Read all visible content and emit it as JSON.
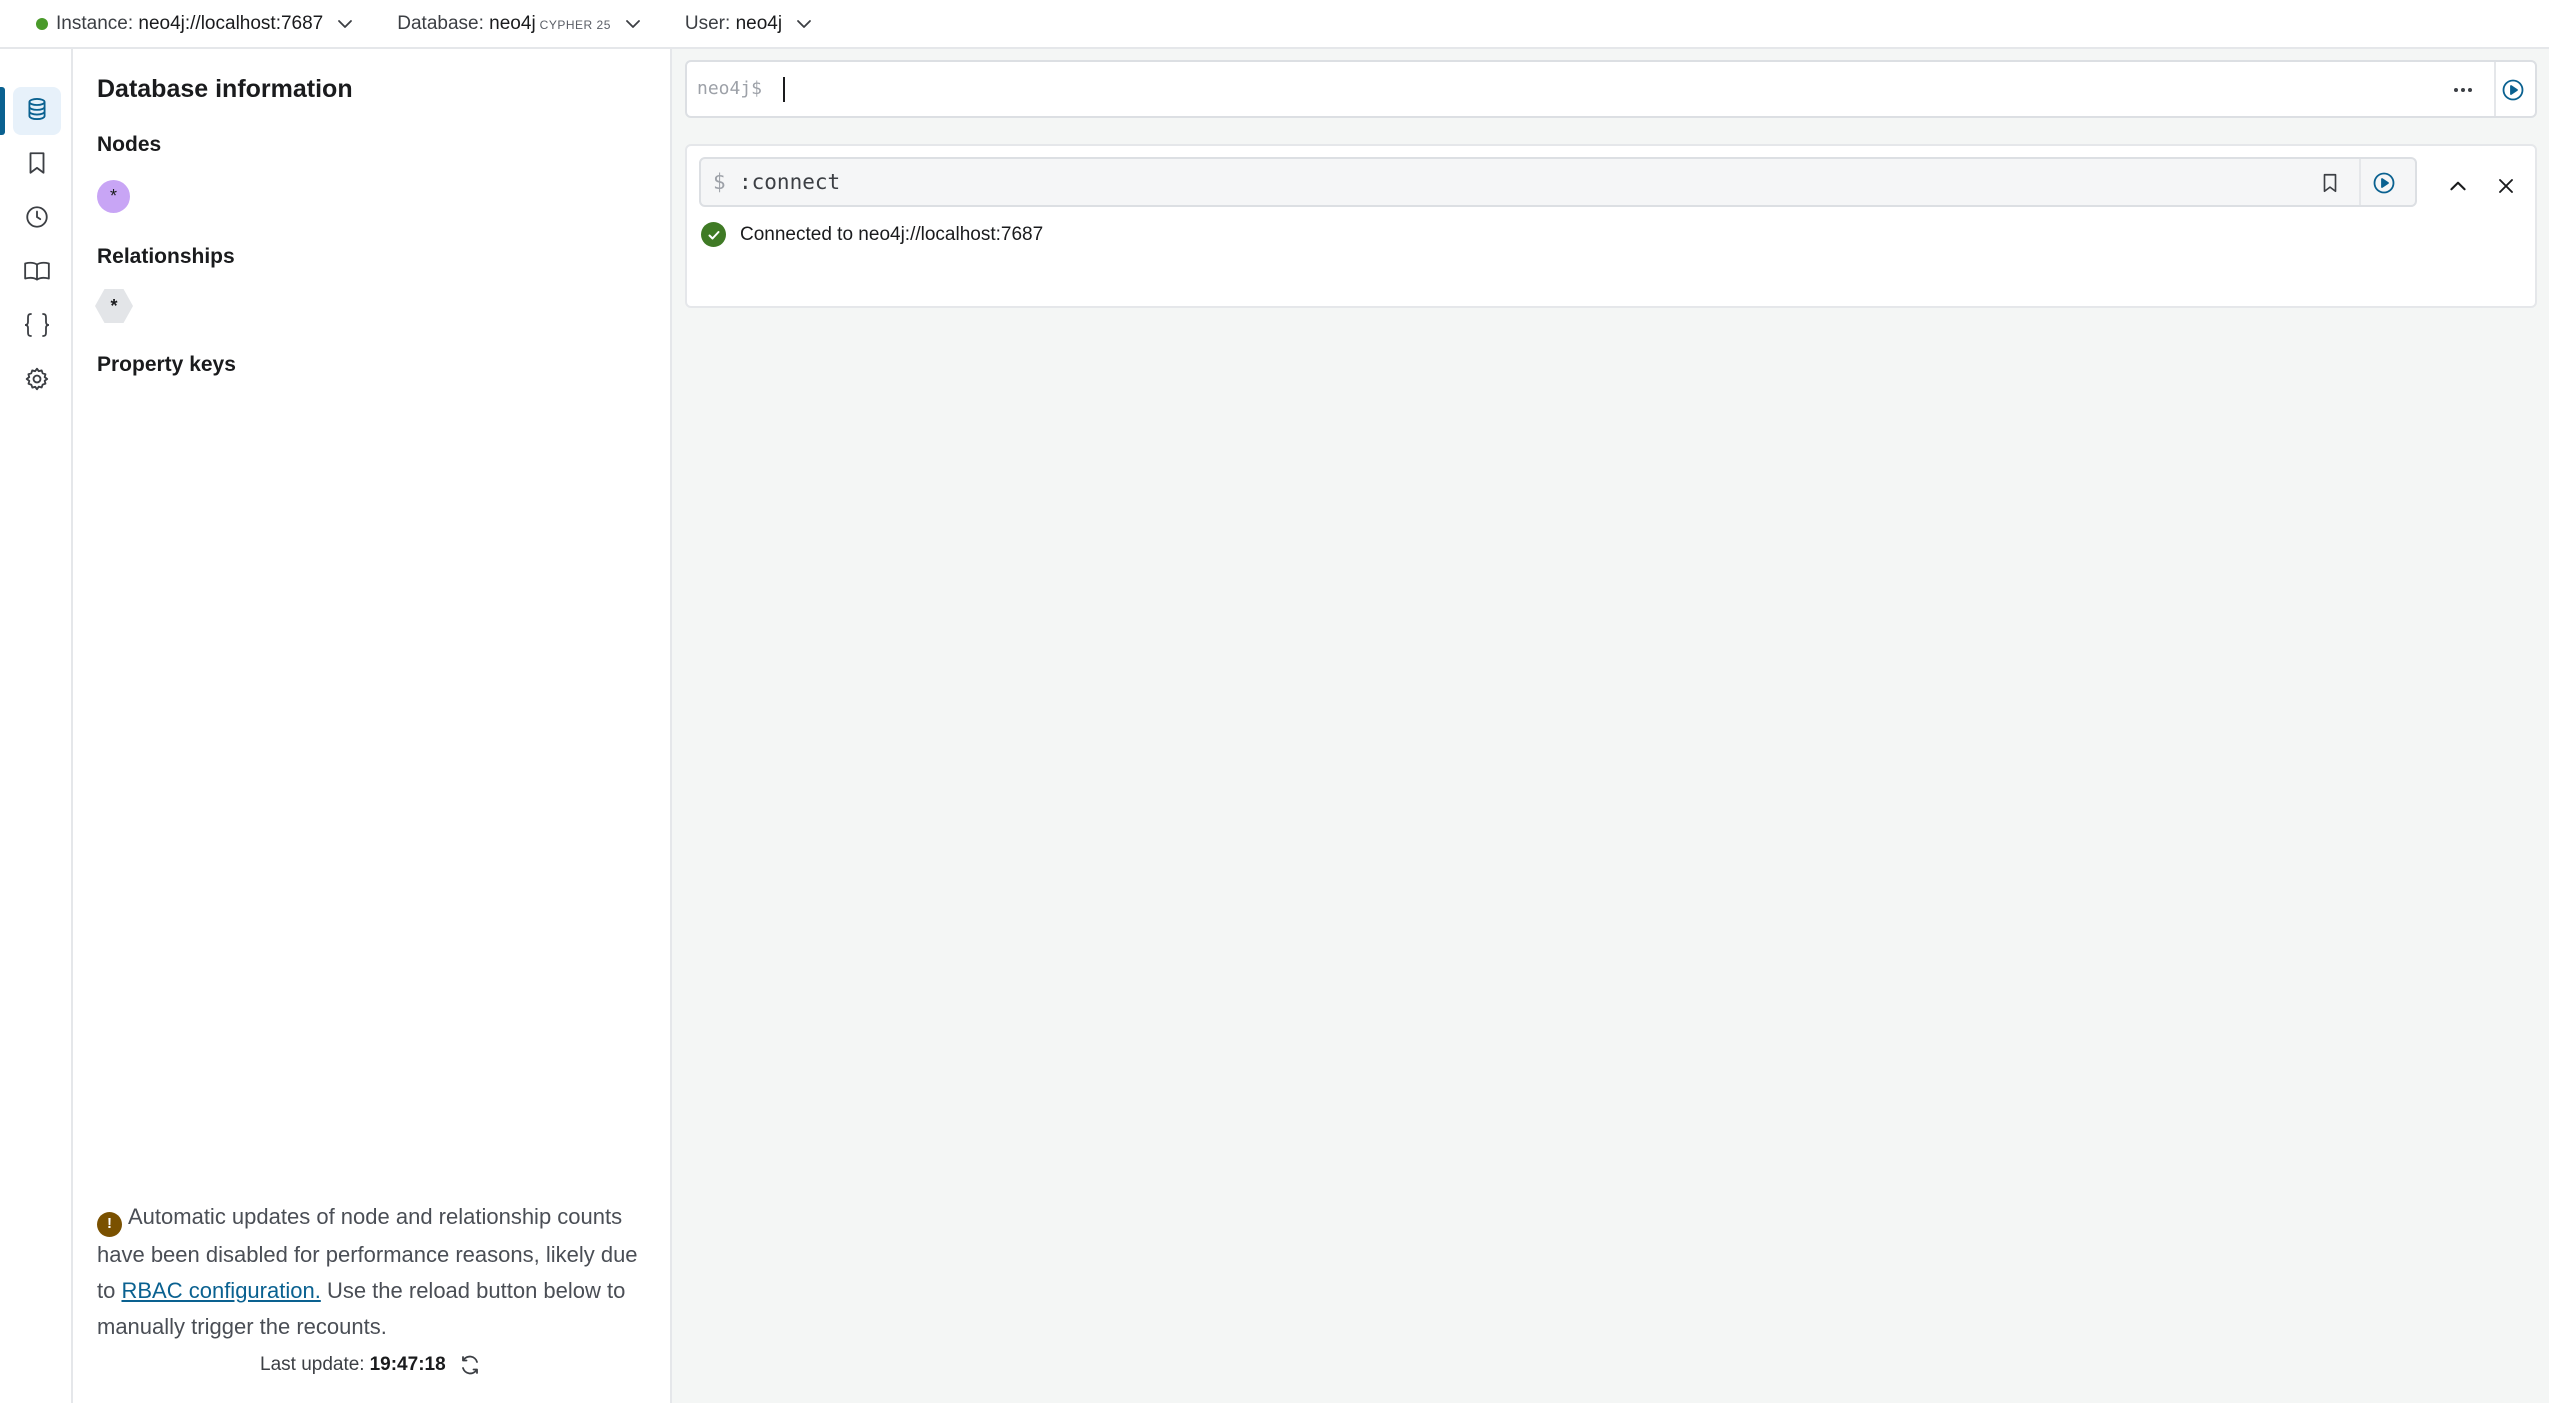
{
  "topbar": {
    "instance_label": "Instance:",
    "instance_value": "neo4j://localhost:7687",
    "database_label": "Database:",
    "database_value": "neo4j",
    "cypher_version": "CYPHER 25",
    "user_label": "User:",
    "user_value": "neo4j"
  },
  "rail": {
    "items": [
      "database-icon",
      "bookmark-icon",
      "history-icon",
      "book-icon",
      "braces-icon",
      "gear-icon"
    ],
    "active": "database-icon"
  },
  "sidebar": {
    "title": "Database information",
    "nodes_heading": "Nodes",
    "node_label": "*",
    "relationships_heading": "Relationships",
    "relationship_label": "*",
    "property_keys_heading": "Property keys",
    "notice": {
      "icon": "!",
      "text_before": "Automatic updates of node and relationship counts have been disabled for performance reasons, likely due to",
      "link": "RBAC configuration.",
      "text_after": "Use the reload button below to manually trigger the recounts."
    },
    "last_update_label": "Last update:",
    "last_update_time": "19:47:18"
  },
  "editor": {
    "prompt": "neo4j$"
  },
  "frame": {
    "dollar": "$",
    "command": ":connect",
    "status": "Connected to neo4j://localhost:7687"
  },
  "colors": {
    "accent": "#0a6190",
    "status_green": "#4a9a2a",
    "node_purple": "#c8a5f5",
    "warning_brown": "#7a5100",
    "success_green": "#3f7a25"
  }
}
